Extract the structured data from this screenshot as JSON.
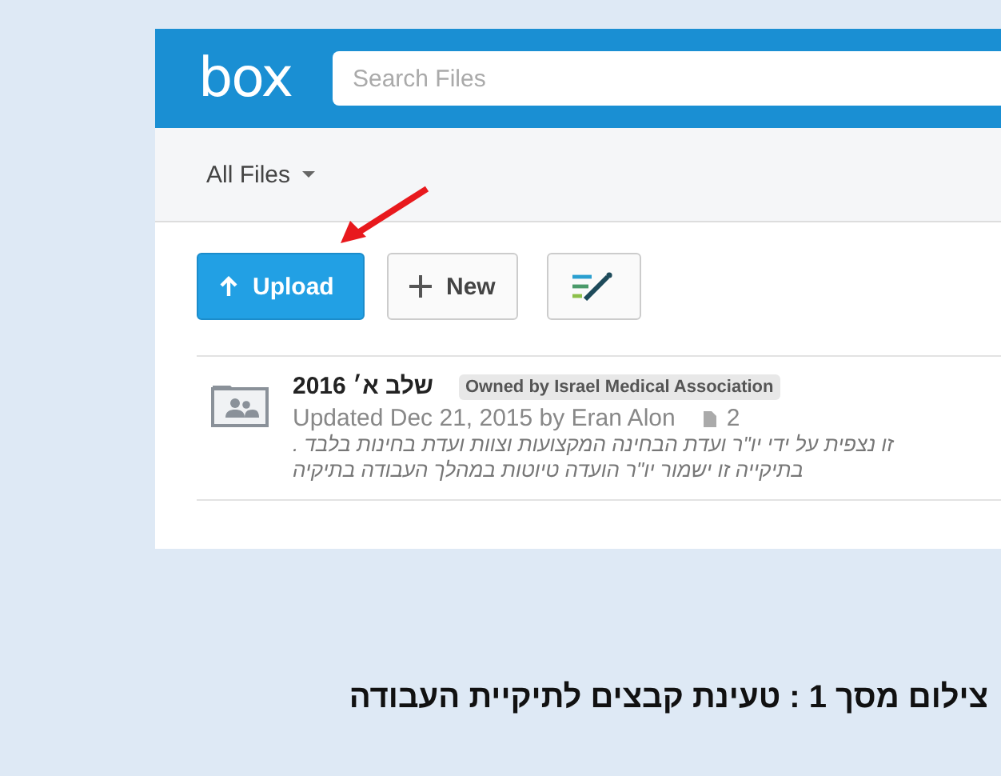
{
  "header": {
    "logo": "box",
    "search": {
      "placeholder": "Search Files"
    }
  },
  "breadcrumb": {
    "label": "All Files"
  },
  "toolbar": {
    "upload_button": {
      "label": "Upload"
    },
    "new_button": {
      "label": "New"
    }
  },
  "files": [
    {
      "name": "שלב א׳ 2016",
      "owner_badge": "Owned by Israel Medical Association",
      "updated": "Updated Dec 21, 2015 by Eran Alon",
      "file_count": "2",
      "description": [
        "זו נצפית על ידי יו\"ר ועדת הבחינה המקצועות וצוות ועדת בחינות בלבד .",
        "בתיקייה זו ישמור יו\"ר הועדה טיוטות במהלך העבודה בתיקיה"
      ]
    }
  ],
  "caption": "צילום מסך 1 : טעינת קבצים לתיקיית העבודה"
}
